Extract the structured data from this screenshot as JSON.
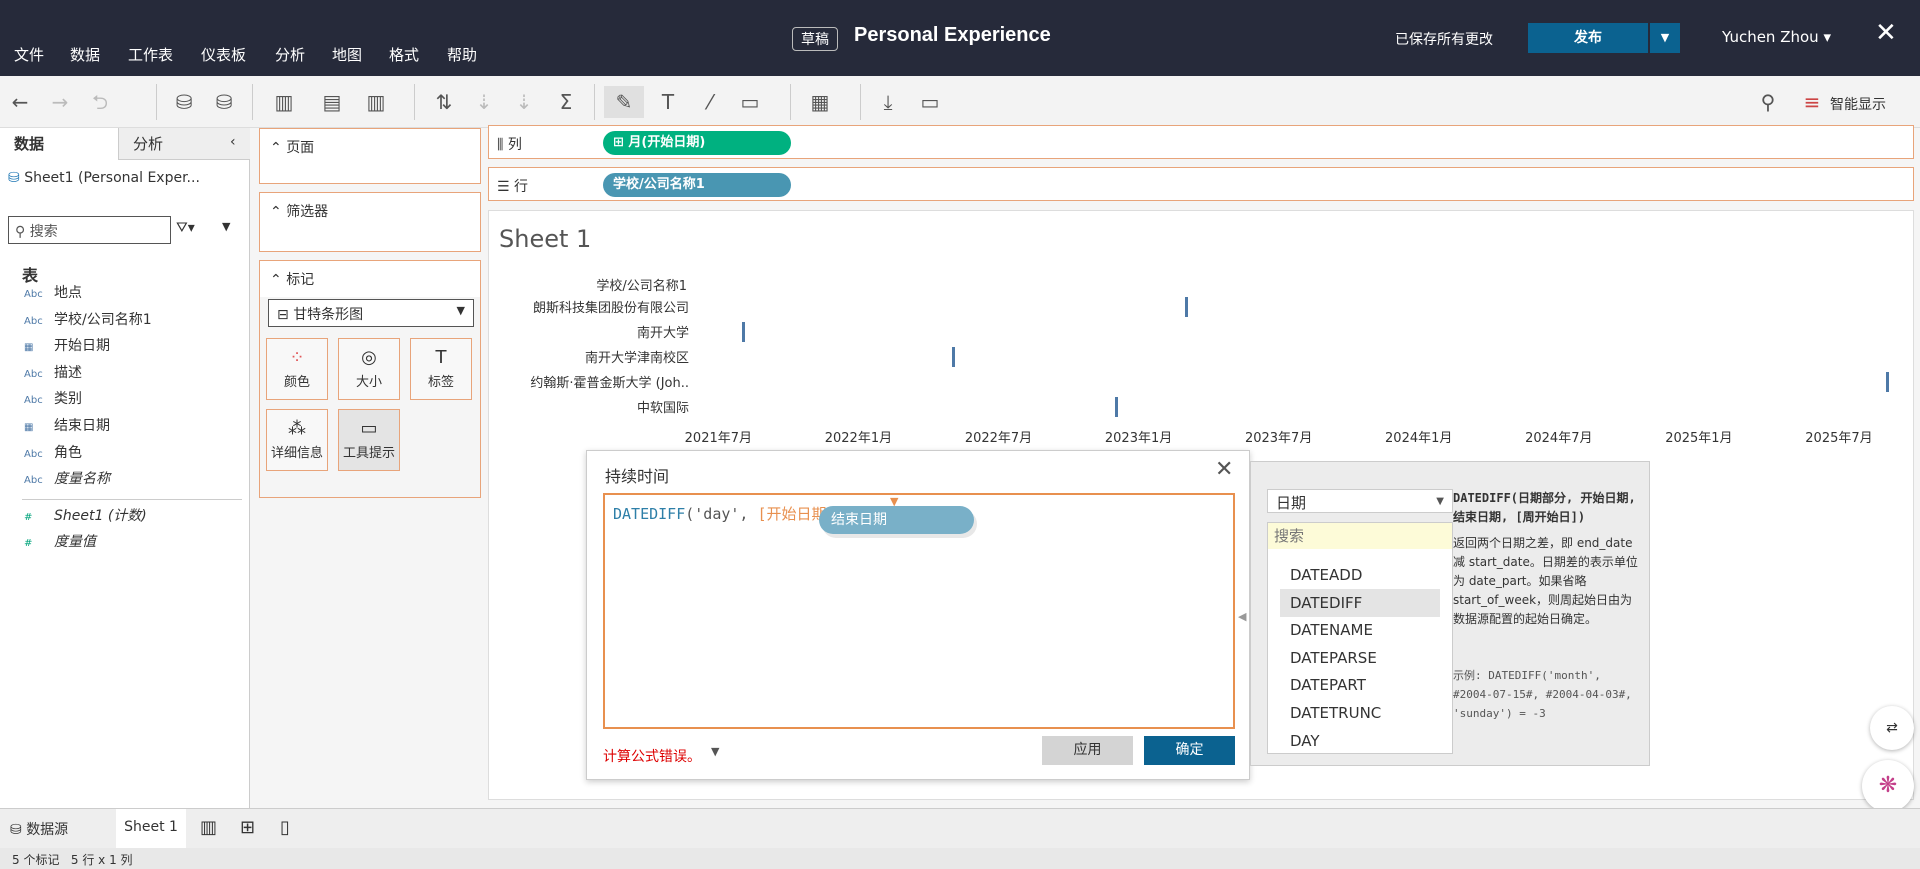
{
  "titlebar": {
    "menu": [
      "文件",
      "数据",
      "工作表",
      "仪表板",
      "分析",
      "地图",
      "格式",
      "帮助"
    ],
    "draft_badge": "草稿",
    "title": "Personal Experience",
    "saved_status": "已保存所有更改",
    "publish": "发布",
    "user": "Yuchen Zhou ▾"
  },
  "toolbar": {
    "smart_show": "智能显示"
  },
  "data_pane": {
    "tabs": [
      "数据",
      "分析"
    ],
    "datasource": "Sheet1 (Personal Exper...",
    "search_placeholder": "搜索",
    "section": "表",
    "fields": [
      {
        "type": "Abc",
        "name": "地点"
      },
      {
        "type": "Abc",
        "name": "学校/公司名称1"
      },
      {
        "type": "date",
        "name": "开始日期"
      },
      {
        "type": "Abc",
        "name": "描述"
      },
      {
        "type": "Abc",
        "name": "类别"
      },
      {
        "type": "date",
        "name": "结束日期"
      },
      {
        "type": "Abc",
        "name": "角色"
      },
      {
        "type": "Abc",
        "name": "度量名称"
      }
    ],
    "measures": [
      "Sheet1 (计数)",
      "度量值"
    ]
  },
  "cards": {
    "pages": "页面",
    "filters": "筛选器",
    "marks": "标记",
    "mark_type": "甘特条形图",
    "buttons": [
      "颜色",
      "大小",
      "标签",
      "详细信息",
      "工具提示"
    ]
  },
  "shelves": {
    "columns_label": "列",
    "columns_pill": "月(开始日期)",
    "rows_label": "行",
    "rows_pill": "学校/公司名称1"
  },
  "sheet": {
    "title": "Sheet 1",
    "row_header": "学校/公司名称1"
  },
  "chart_data": {
    "type": "gantt",
    "xlabel": "开始日期 (月)",
    "ylabel": "学校/公司名称1",
    "categories": [
      "朗斯科技集团股份有限公司",
      "南开大学",
      "南开大学津南校区",
      "约翰斯·霍普金斯大学 (Joh..",
      "中软国际"
    ],
    "values": [
      "2023-03",
      "2021-08",
      "2022-05",
      "2025-09",
      "2022-12"
    ],
    "x_ticks": [
      "2021年7月",
      "2022年1月",
      "2022年7月",
      "2023年1月",
      "2023年7月",
      "2024年1月",
      "2024年7月",
      "2025年1月",
      "2025年7月"
    ],
    "xlim": [
      "2021-06",
      "2025-10"
    ]
  },
  "dialog": {
    "title": "持续时间",
    "formula_parts": [
      "DATEDIFF",
      "('day', ",
      "[开始日期]",
      ")"
    ],
    "drag_pill": "结束日期",
    "error": "计算公式错误。",
    "apply": "应用",
    "ok": "确定"
  },
  "function_panel": {
    "category": "日期",
    "search_placeholder": "搜索",
    "functions": [
      "DATEADD",
      "DATEDIFF",
      "DATENAME",
      "DATEPARSE",
      "DATEPART",
      "DATETRUNC",
      "DAY"
    ],
    "selected": "DATEDIFF",
    "signature": "DATEDIFF(日期部分, 开始日期, 结束日期, [周开始日])",
    "description": "返回两个日期之差，即 end_date 减 start_date。日期差的表示单位为 date_part。如果省略 start_of_week，则周起始日由为数据源配置的起始日确定。",
    "example": "示例: DATEDIFF('month', #2004-07-15#, #2004-04-03#, 'sunday') = -3"
  },
  "tabs": {
    "datasource": "数据源",
    "sheet": "Sheet 1"
  },
  "status": {
    "marks": "5 个标记",
    "dims": "5 行 x 1 列"
  }
}
